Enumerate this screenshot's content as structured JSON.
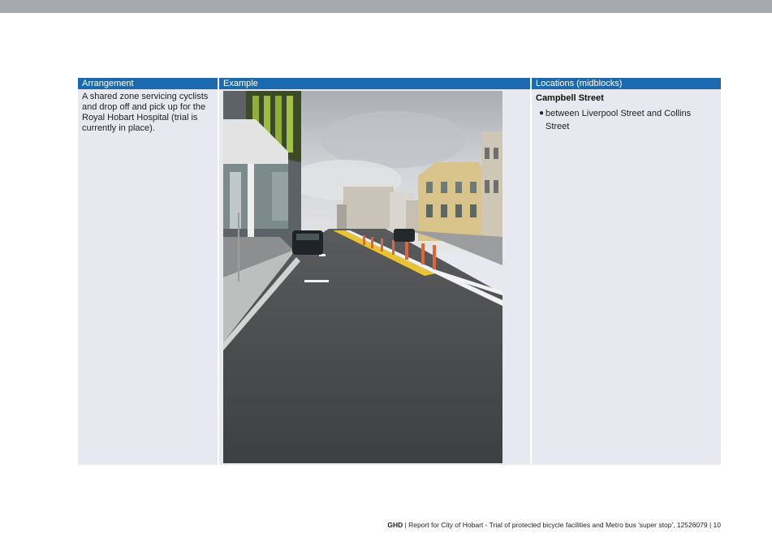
{
  "table": {
    "headers": [
      "Arrangement",
      "Example",
      "Locations (midblocks)"
    ],
    "arrangement_text": "A shared zone servicing cyclists and drop off and pick up for the Royal Hobart Hospital (trial is currently in place).",
    "locations": {
      "street": "Campbell Street",
      "items": [
        "between Liverpool Street and Collins Street"
      ]
    }
  },
  "photo": {
    "description_icon": "street-photo",
    "colors": {
      "sky": "#c9ccd0",
      "asphalt": "#4a4b4d",
      "bollard": "#e0643a",
      "kerb_yellow": "#e8c23a"
    }
  },
  "footer": {
    "brand": "GHD",
    "text": " | Report for City of Hobart - Trial of protected bicycle facilities and Metro bus 'super stop', 12526079 | 10"
  }
}
